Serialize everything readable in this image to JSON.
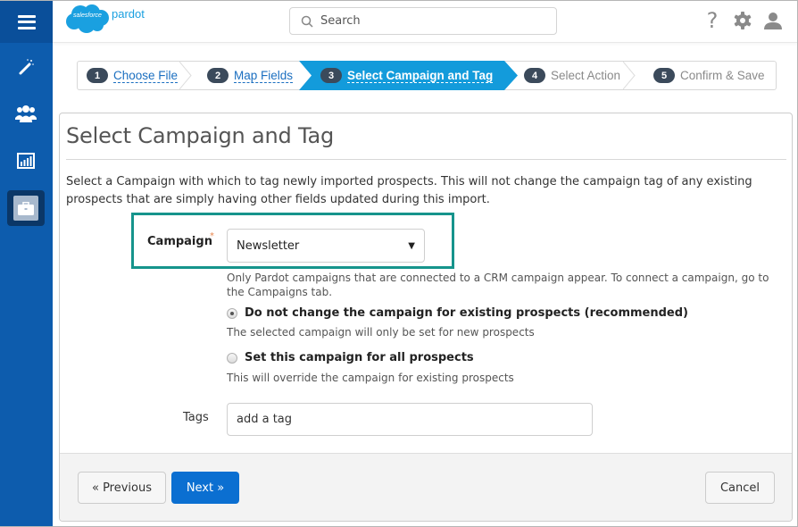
{
  "header": {
    "logo_cloud_text": "salesforce",
    "logo_product": "pardot",
    "search_placeholder": "Search",
    "icons": [
      "help-icon",
      "gear-icon",
      "user-icon"
    ],
    "help_glyph": "?"
  },
  "sidebar": {
    "items": [
      {
        "name": "menu",
        "icon": "hamburger-icon"
      },
      {
        "name": "marketing",
        "icon": "magic-wand-icon"
      },
      {
        "name": "prospects",
        "icon": "people-icon"
      },
      {
        "name": "reports",
        "icon": "bar-chart-icon"
      },
      {
        "name": "admin",
        "icon": "briefcase-icon",
        "active": true
      }
    ]
  },
  "wizard": {
    "steps": [
      {
        "num": "1",
        "label": "Choose File",
        "state": "completed"
      },
      {
        "num": "2",
        "label": "Map Fields",
        "state": "completed"
      },
      {
        "num": "3",
        "label": "Select Campaign and Tag",
        "state": "active"
      },
      {
        "num": "4",
        "label": "Select Action",
        "state": "future"
      },
      {
        "num": "5",
        "label": "Confirm & Save",
        "state": "future"
      }
    ],
    "active_color": "#139bdb"
  },
  "page": {
    "title": "Select Campaign and Tag",
    "intro": "Select a Campaign with which to tag newly imported prospects. This will not change the campaign tag of any existing prospects that are simply having other fields updated during this import.",
    "campaign_label": "Campaign",
    "required_mark": "*",
    "campaign_value": "Newsletter",
    "campaign_caret": "▼",
    "campaign_hint": "Only Pardot campaigns that are connected to a CRM campaign appear. To connect a campaign, go to the Campaigns tab.",
    "options": [
      {
        "label": "Do not change the campaign for existing prospects (recommended)",
        "hint": "The selected campaign will only be set for new prospects",
        "checked": true
      },
      {
        "label": "Set this campaign for all prospects",
        "hint": "This will override the campaign for existing prospects",
        "checked": false
      }
    ],
    "tags_label": "Tags",
    "tags_placeholder": "add a tag",
    "highlight_color": "#16948c"
  },
  "footer": {
    "previous_label": "« Previous",
    "next_label": "Next »",
    "cancel_label": "Cancel"
  }
}
